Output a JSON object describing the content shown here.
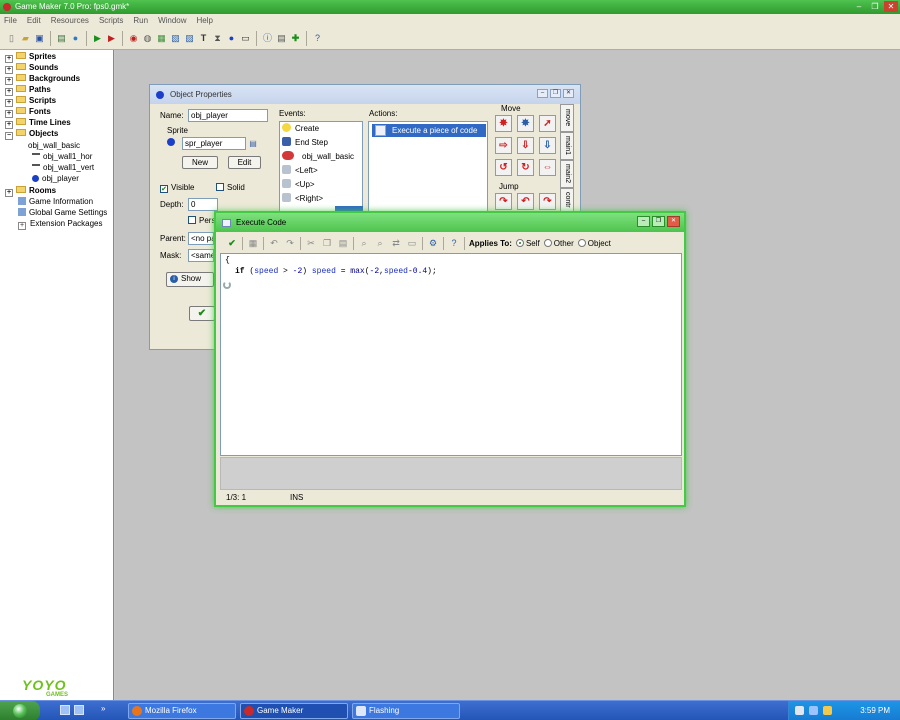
{
  "app": {
    "title": "Game Maker 7.0 Pro: fps0.gmk*",
    "menu": [
      "File",
      "Edit",
      "Resources",
      "Scripts",
      "Run",
      "Window",
      "Help"
    ]
  },
  "tree": {
    "items": [
      {
        "label": "Sprites",
        "bold": true
      },
      {
        "label": "Sounds",
        "bold": true
      },
      {
        "label": "Backgrounds",
        "bold": true
      },
      {
        "label": "Paths",
        "bold": true
      },
      {
        "label": "Scripts",
        "bold": true
      },
      {
        "label": "Fonts",
        "bold": true
      },
      {
        "label": "Time Lines",
        "bold": true
      },
      {
        "label": "Objects",
        "bold": true
      },
      {
        "label": "obj_wall_basic"
      },
      {
        "label": "obj_wall1_hor"
      },
      {
        "label": "obj_wall1_vert"
      },
      {
        "label": "obj_player"
      },
      {
        "label": "Rooms",
        "bold": true
      },
      {
        "label": "Game Information"
      },
      {
        "label": "Global Game Settings"
      },
      {
        "label": "Extension Packages"
      }
    ]
  },
  "logo": {
    "text": "YOYO",
    "sub": "GAMES"
  },
  "object_window": {
    "title": "Object Properties",
    "name_label": "Name:",
    "name_value": "obj_player",
    "sprite_label": "Sprite",
    "sprite_value": "spr_player",
    "new_label": "New",
    "edit_label": "Edit",
    "visible_label": "Visible",
    "solid_label": "Solid",
    "depth_label": "Depth:",
    "depth_value": "0",
    "persistent_label": "Pers",
    "parent_label": "Parent:",
    "parent_value": "<no pa",
    "mask_label": "Mask:",
    "mask_value": "<same",
    "show_label": "Show",
    "events_label": "Events:",
    "actions_label": "Actions:",
    "events": [
      "Create",
      "End Step",
      "obj_wall_basic",
      "<Left>",
      "<Up>",
      "<Right>"
    ],
    "action_selected": "Execute a piece of code",
    "palette_move_label": "Move",
    "palette_jump_label": "Jump",
    "tabs": [
      "move",
      "main1",
      "main2",
      "contr"
    ]
  },
  "code_window": {
    "title": "Execute Code",
    "applies_to_label": "Applies To:",
    "self_label": "Self",
    "other_label": "Other",
    "object_label": "Object",
    "code_line1": "{",
    "code_if": "if",
    "code_paren_open": "(",
    "code_speed1": "speed",
    "code_gt": " > ",
    "code_num1": "-2",
    "code_paren_close": ") ",
    "code_speed2": "speed",
    "code_eq": " = ",
    "code_fn": "max",
    "code_args_open": "(",
    "code_num2": "-2",
    "code_comma": ",",
    "code_speed3": "speed",
    "code_minus": "-",
    "code_num3": "0.4",
    "code_end": ");",
    "cursor_pos": "1/3:  1",
    "mode": "INS"
  },
  "taskbar": {
    "tasks": [
      "Mozilla Firefox",
      "Game Maker",
      "Flashing"
    ],
    "clock": "3:59 PM"
  },
  "colors": {
    "accent_green": "#43c943",
    "selection_blue": "#316ac5",
    "taskbar_blue": "#2456b8"
  }
}
